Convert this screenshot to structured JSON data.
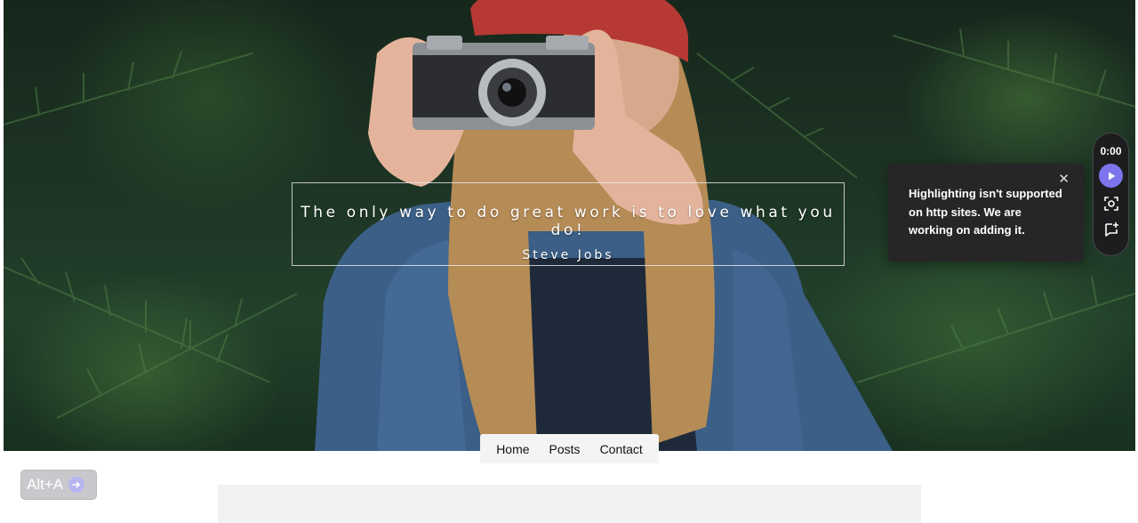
{
  "hero": {
    "quote": "The only way to do great work is to love what you do!",
    "author": "Steve Jobs"
  },
  "nav": {
    "items": [
      {
        "label": "Home"
      },
      {
        "label": "Posts"
      },
      {
        "label": "Contact"
      }
    ]
  },
  "shortcut_badge": {
    "label": "Alt+A",
    "icon": "arrow-right-icon"
  },
  "tooltip": {
    "message": "Highlighting isn't supported on http sites. We are working on adding it.",
    "close_icon": "close-icon"
  },
  "recorder": {
    "timer": "0:00",
    "accent_color": "#7b74ec",
    "tools": [
      "play-icon",
      "screenshot-icon",
      "add-highlight-icon"
    ]
  }
}
